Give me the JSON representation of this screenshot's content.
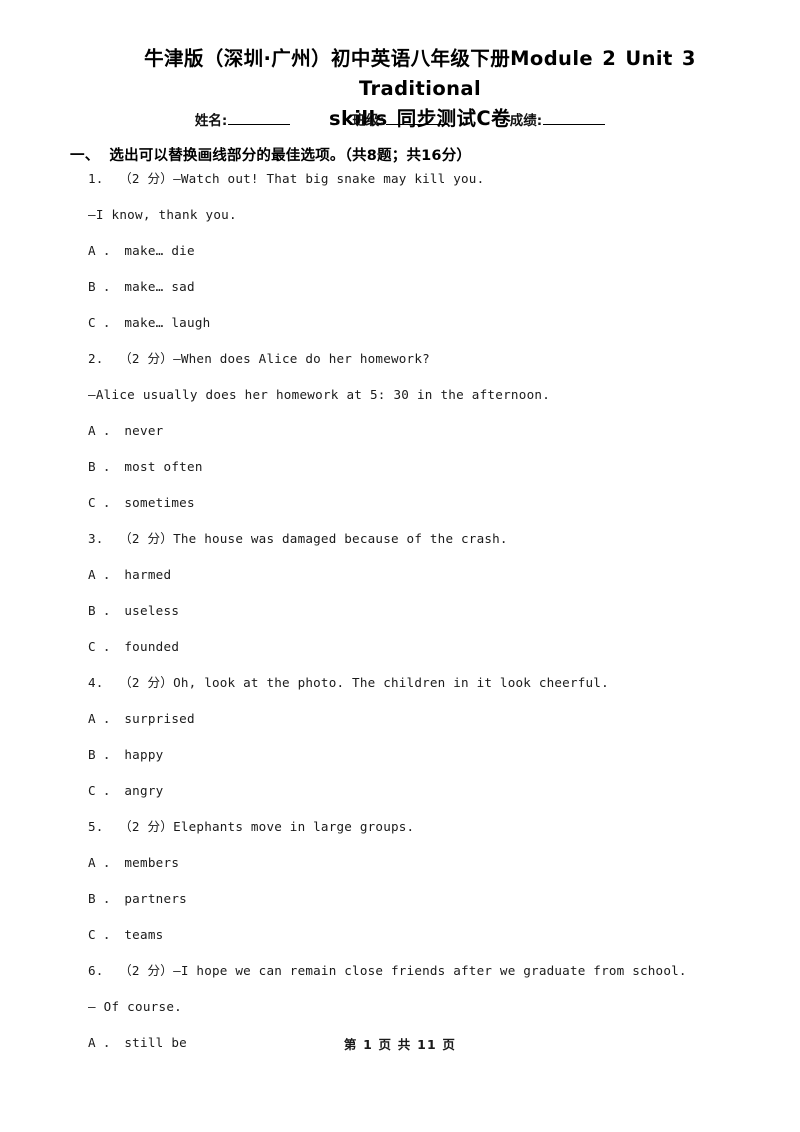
{
  "document": {
    "title_line_1": "牛津版（深圳·广州）初中英语八年级下册Module 2  Unit 3 Traditional",
    "title_line_2": "skills 同步测试C卷",
    "footer": "第 1 页 共 11 页"
  },
  "student_info": {
    "name_label": "姓名:",
    "class_label": "班级:",
    "score_label": "成绩:"
  },
  "section": {
    "number": "一、",
    "heading": "选出可以替换画线部分的最佳选项。（共8题；共16分）"
  },
  "questions": [
    {
      "number": "1.",
      "points": "（2 分）",
      "stem": "—Watch out! That big snake may kill you.",
      "stem_continuation": "—I know, thank you.",
      "options": [
        {
          "letter": "A ．",
          "text": "make… die"
        },
        {
          "letter": "B ．",
          "text": "make… sad"
        },
        {
          "letter": "C ．",
          "text": "make… laugh"
        }
      ]
    },
    {
      "number": "2.",
      "points": "（2 分）",
      "stem": "—When does Alice do her homework?",
      "stem_continuation": "—Alice usually does her homework at 5: 30 in the afternoon.",
      "options": [
        {
          "letter": "A ．",
          "text": "never"
        },
        {
          "letter": "B ．",
          "text": "most often"
        },
        {
          "letter": "C ．",
          "text": "sometimes"
        }
      ]
    },
    {
      "number": "3.",
      "points": "（2 分）",
      "stem": "The house was damaged because of the crash.",
      "stem_continuation": "",
      "options": [
        {
          "letter": "A ．",
          "text": "harmed"
        },
        {
          "letter": "B ．",
          "text": "useless"
        },
        {
          "letter": "C ．",
          "text": "founded"
        }
      ]
    },
    {
      "number": "4.",
      "points": "（2 分）",
      "stem": "Oh, look at the photo. The children in it look cheerful.",
      "stem_continuation": "",
      "options": [
        {
          "letter": "A ．",
          "text": "surprised"
        },
        {
          "letter": "B ．",
          "text": "happy"
        },
        {
          "letter": "C ．",
          "text": "angry"
        }
      ]
    },
    {
      "number": "5.",
      "points": "（2 分）",
      "stem": "Elephants move in large groups.",
      "stem_continuation": "",
      "options": [
        {
          "letter": "A ．",
          "text": "members"
        },
        {
          "letter": "B ．",
          "text": "partners"
        },
        {
          "letter": "C ．",
          "text": "teams"
        }
      ]
    },
    {
      "number": "6.",
      "points": "（2 分）",
      "stem": "—I hope we can remain close friends after we graduate from school.",
      "stem_continuation": "— Of course.",
      "options": [
        {
          "letter": "A ．",
          "text": "still be"
        }
      ]
    }
  ],
  "lines": [
    {
      "kind": "question",
      "text": "1.  （2 分）—Watch out! That big snake may kill you."
    },
    {
      "kind": "continuation",
      "text": "—I know, thank you."
    },
    {
      "kind": "option",
      "text": "A ． make… die"
    },
    {
      "kind": "option",
      "text": "B ． make… sad"
    },
    {
      "kind": "option",
      "text": "C ． make… laugh"
    },
    {
      "kind": "question",
      "text": "2.  （2 分）—When does Alice do her homework?"
    },
    {
      "kind": "continuation",
      "text": "—Alice usually does her homework at 5: 30 in the afternoon."
    },
    {
      "kind": "option",
      "text": "A ． never"
    },
    {
      "kind": "option",
      "text": "B ． most often"
    },
    {
      "kind": "option",
      "text": "C ． sometimes"
    },
    {
      "kind": "question",
      "text": "3.  （2 分）The house was damaged because of the crash."
    },
    {
      "kind": "option",
      "text": "A ． harmed"
    },
    {
      "kind": "option",
      "text": "B ． useless"
    },
    {
      "kind": "option",
      "text": "C ． founded"
    },
    {
      "kind": "question",
      "text": "4.  （2 分）Oh, look at the photo. The children in it look cheerful."
    },
    {
      "kind": "option",
      "text": "A ． surprised"
    },
    {
      "kind": "option",
      "text": "B ． happy"
    },
    {
      "kind": "option",
      "text": "C ． angry"
    },
    {
      "kind": "question",
      "text": "5.  （2 分）Elephants move in large groups."
    },
    {
      "kind": "option",
      "text": "A ． members"
    },
    {
      "kind": "option",
      "text": "B ． partners"
    },
    {
      "kind": "option",
      "text": "C ． teams"
    },
    {
      "kind": "question",
      "text": "6.  （2 分）—I hope we can remain close friends after we graduate from school."
    },
    {
      "kind": "continuation",
      "text": "— Of course."
    },
    {
      "kind": "option",
      "text": "A ． still be"
    }
  ]
}
